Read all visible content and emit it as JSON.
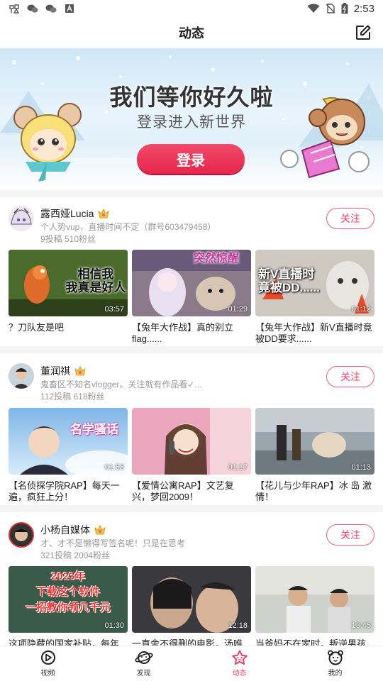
{
  "status_bar": {
    "time": "2:53"
  },
  "header": {
    "title": "动态"
  },
  "banner": {
    "title": "我们等你好久啦",
    "subtitle": "登录进入新世界",
    "login_label": "登录"
  },
  "users": [
    {
      "name": "露西娅Lucia",
      "desc": "个人势vup，直播时间不定（群号603479458）",
      "stats": "9投稿   510粉丝",
      "follow_label": "关注",
      "videos": [
        {
          "title": "？刀队友是吧",
          "duration": "03:57",
          "overlay": "相信我\n我真是好人"
        },
        {
          "title": "【兔年大作战】真的别立flag......",
          "duration": "01:29",
          "overlay": "突然惊醒"
        },
        {
          "title": "【兔年大作战】新V直播时竟被DD要求......",
          "duration": "01:12",
          "overlay": "新V直播时\n竟被DD......"
        }
      ]
    },
    {
      "name": "董润祺",
      "desc": "鬼畜区不知名vlogger。关注就有作品看✓...",
      "stats": "112投稿   618粉丝",
      "follow_label": "关注",
      "videos": [
        {
          "title": "【名侦探学院RAP】每天一遍，疯狂上分！",
          "duration": "01:53",
          "overlay": "名学骚话"
        },
        {
          "title": "【爱情公寓RAP】文艺复兴，梦回2009！",
          "duration": "01:17",
          "overlay": ""
        },
        {
          "title": "【花儿与少年RAP】冰 岛 激 情！",
          "duration": "01:13",
          "overlay": ""
        }
      ]
    },
    {
      "name": "小杨自媒体",
      "desc": "才、才不是懒得写签名呢！只是在思考",
      "stats": "321投稿   2004粉丝",
      "follow_label": "关注",
      "videos": [
        {
          "title": "这项隐藏的国家补贴，每年",
          "duration": "01:30",
          "overlay": "2023年\n下载这个软件\n一招教你领几千元"
        },
        {
          "title": "一直舍不得删的电影，汤唯",
          "duration": "12:18",
          "overlay": ""
        },
        {
          "title": "当爸妈不在家时，叛逆男孩",
          "duration": "13:45",
          "overlay": ""
        }
      ]
    }
  ],
  "tabs": [
    {
      "label": "视频",
      "icon": "video-icon"
    },
    {
      "label": "发现",
      "icon": "planet-icon"
    },
    {
      "label": "动态",
      "icon": "star-icon"
    },
    {
      "label": "我的",
      "icon": "profile-icon"
    }
  ],
  "colors": {
    "accent": "#f03e62",
    "divider": "#f4f4f4"
  }
}
